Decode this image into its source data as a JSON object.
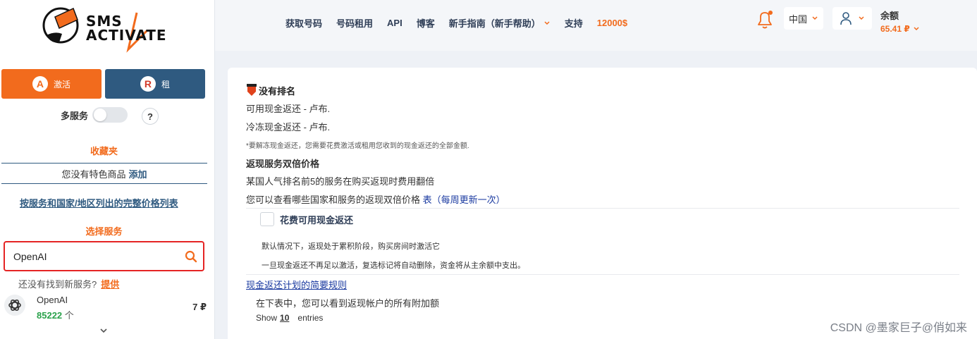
{
  "logo": {
    "line1": "SMS",
    "line2": "ACTIVATE"
  },
  "sidebar": {
    "activate_label": "激活",
    "rent_label": "租",
    "multi_service_label": "多服务",
    "help_label": "?",
    "favorites_title": "收藏夹",
    "favorites_empty_text": "您没有特色商品",
    "favorites_add": "添加",
    "price_list_link": "按服务和国家/地区列出的完整价格列表",
    "select_service_title": "选择服务",
    "search_value": "OpenAI",
    "not_found_text": "还没有找到新服务?",
    "suggest_link": "提供",
    "service": {
      "name": "OpenAI",
      "count": "85222",
      "count_unit": "个",
      "price": "7 ₽"
    }
  },
  "header": {
    "nav": [
      "获取号码",
      "号码租用",
      "API",
      "博客",
      "新手指南（新手帮助）",
      "支持"
    ],
    "promo": "12000$",
    "country": "中国",
    "balance_label": "余额",
    "balance_value": "65.41 ₽"
  },
  "main": {
    "rank_title": "没有排名",
    "cashback_available": "可用现金返还 - 卢布.",
    "cashback_frozen": "冷冻现金返还 - 卢布.",
    "unfreeze_note": "*要解冻现金返还，您需要花费激活或租用您收到的现金返还的全部金额.",
    "double_title": "返现服务双倍价格",
    "double_desc": "某国人气排名前5的服务在购买返现时费用翻倍",
    "double_table_text": "您可以查看哪些国家和服务的返现双倍价格",
    "double_table_link": "表（每周更新一次）",
    "spend_checkbox_label": "花费可用现金返还",
    "default_note": "默认情况下，返现处于累积阶段，购买房间时激活它",
    "auto_remove_note": "一旦现金返还不再足以激活，复选标记将自动删除，资金将从主余额中支出。",
    "rules_link": "现金返还计划的简要规则",
    "table_intro": "在下表中，您可以看到返现帐户的所有附加额",
    "show_label": "Show",
    "show_count": "10",
    "entries_label": "entries"
  },
  "watermark": "CSDN @墨家巨子@俏如来",
  "colors": {
    "orange": "#f26b1d",
    "navy": "#2f5a80",
    "red_border": "#e52424",
    "green": "#2aa24b"
  }
}
